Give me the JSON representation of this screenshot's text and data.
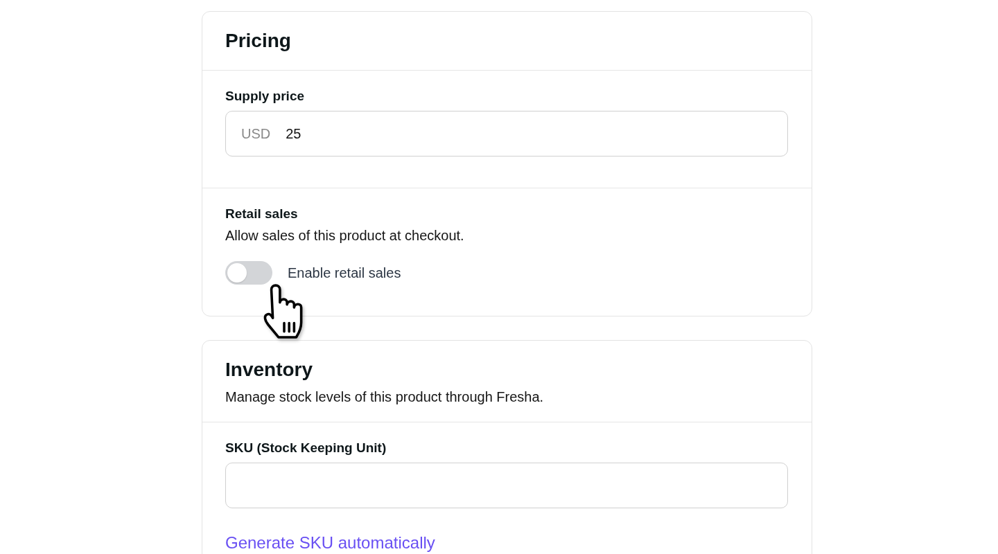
{
  "pricing": {
    "title": "Pricing",
    "supply_price": {
      "label": "Supply price",
      "currency": "USD",
      "value": "25"
    },
    "retail_sales": {
      "title": "Retail sales",
      "description": "Allow sales of this product at checkout.",
      "toggle": {
        "label": "Enable retail sales",
        "on": false
      }
    }
  },
  "inventory": {
    "title": "Inventory",
    "description": "Manage stock levels of this product through Fresha.",
    "sku": {
      "label": "SKU (Stock Keeping Unit)"
    },
    "generate_link": "Generate SKU automatically"
  }
}
